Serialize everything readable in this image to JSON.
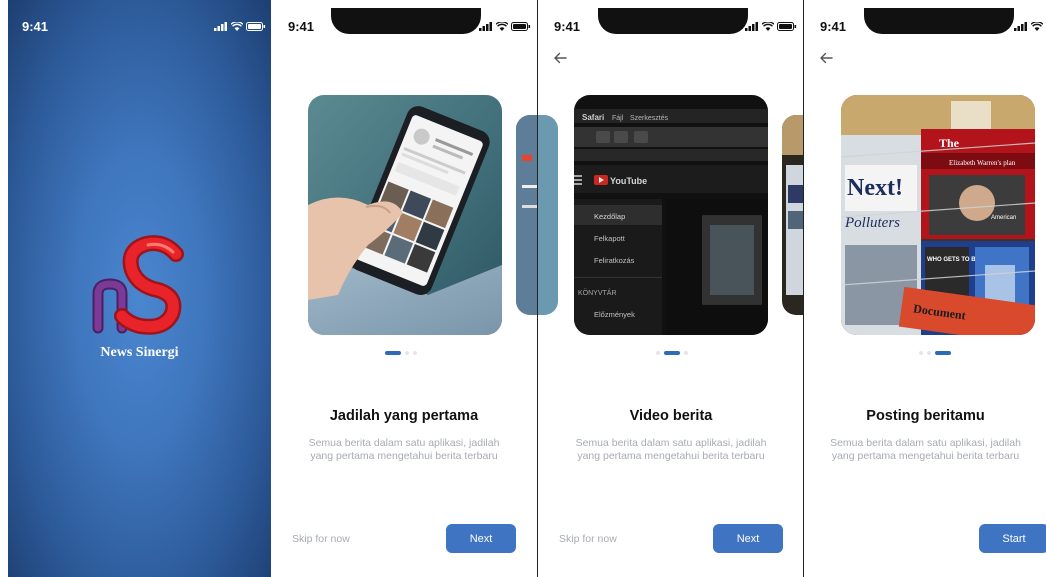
{
  "status_bar": {
    "time": "9:41"
  },
  "splash": {
    "logo_text": "nS",
    "brand_name": "News Sinergi"
  },
  "onboarding": [
    {
      "title": "Jadilah yang pertama",
      "description_line1": "Semua berita dalam satu aplikasi, jadilah",
      "description_line2": "yang pertama mengetahui berita terbaru",
      "skip_label": "Skip for now",
      "button_label": "Next",
      "active_page": 1,
      "total_pages": 3,
      "image": "phone-in-hand-photo"
    },
    {
      "title": "Video berita",
      "description_line1": "Semua berita dalam satu aplikasi, jadilah",
      "description_line2": "yang pertama mengetahui berita terbaru",
      "skip_label": "Skip for now",
      "button_label": "Next",
      "active_page": 2,
      "total_pages": 3,
      "image": "youtube-browser-photo",
      "browser_text": {
        "tab_safari": "Safari",
        "tab_fajl": "Fájl",
        "tab_szerk": "Szerkesztés",
        "youtube": "YouTube",
        "menu1": "Kezdőlap",
        "menu2": "Felkapott",
        "menu3": "Feliratkozás",
        "section": "KÖNYVTÁR",
        "menu4": "Előzmények"
      }
    },
    {
      "title": "Posting beritamu",
      "description_line1": "Semua berita dalam satu aplikasi, jadilah",
      "description_line2": "yang pertama mengetahui berita terbaru",
      "button_label": "Start",
      "active_page": 3,
      "total_pages": 3,
      "image": "magazine-rack-photo",
      "magazine_text": {
        "mag1": "The",
        "mag2": "Elizabeth Warren's plan",
        "mag3": "Next!",
        "mag4": "Polluters",
        "mag5": "American",
        "mag6": "WHO GETS TO BE HEALTHY",
        "mag7": "Document"
      }
    }
  ],
  "colors": {
    "primary": "#3e74c2",
    "dot_active": "#2e6bb5",
    "splash_bg": "#3f76bd",
    "logo_red": "#e8232a",
    "logo_purple": "#6f2f86",
    "muted_text": "#a7abb3"
  }
}
